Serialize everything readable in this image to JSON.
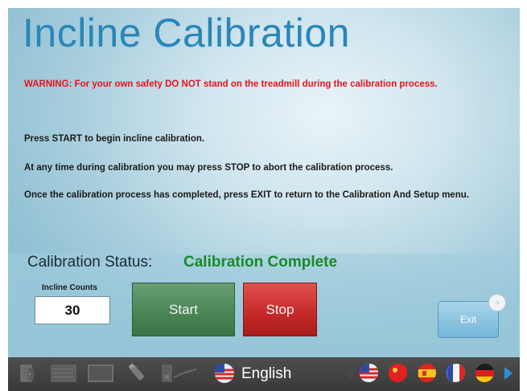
{
  "screen": {
    "title": "Incline Calibration",
    "warning": "WARNING: For your own safety DO NOT stand on the treadmill during the calibration process.",
    "instructions": [
      "Press START to begin incline calibration.",
      "At any time during calibration you may press STOP to abort the calibration process.",
      "Once the calibration process has completed, press EXIT to return to the Calibration And Setup menu."
    ],
    "status_label": "Calibration Status:",
    "status_value": "Calibration Complete",
    "counts_label": "Incline Counts",
    "counts_value": "30",
    "start_label": "Start",
    "stop_label": "Stop",
    "exit_label": "Exit"
  },
  "taskbar": {
    "language": "English",
    "icons": [
      "door-icon",
      "monitor-icon",
      "screen-icon",
      "usb-icon",
      "network-icon",
      "arrow-left-icon",
      "flag-us-icon",
      "flag-china-icon",
      "flag-spain-icon",
      "flag-france-icon",
      "flag-germany-icon",
      "arrow-right-icon"
    ]
  },
  "colors": {
    "title": "#2a86b8",
    "warning": "#e8121c",
    "status_value": "#1a8a2a",
    "start": "#4b8656",
    "stop": "#c52828",
    "exit": "#76b6d8",
    "taskbar": "#3f3f3f"
  }
}
